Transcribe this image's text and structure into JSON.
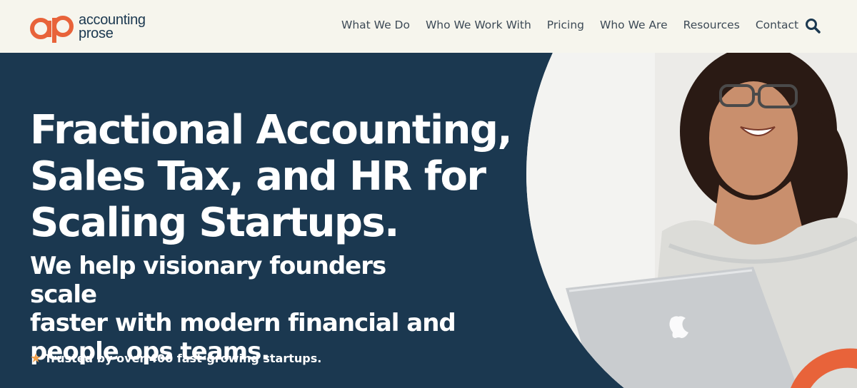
{
  "brand": {
    "logo_mark": "ap",
    "name_line1": "accounting",
    "name_line2": "prose",
    "accent_color": "#e8633a",
    "navy_color": "#1b3850"
  },
  "nav": {
    "items": [
      "What We Do",
      "Who We Work With",
      "Pricing",
      "Who We Are",
      "Resources",
      "Contact"
    ],
    "search_icon": "search-icon"
  },
  "hero": {
    "headline_lines": [
      "Fractional Accounting,",
      "Sales Tax, and HR for",
      "Scaling Startups."
    ],
    "subhead_lines": [
      "We help visionary founders scale",
      "faster with modern financial and",
      "people ops teams."
    ],
    "trust_icon": "star-icon",
    "trust_text": "Trusted by over 400 fast-growing startups."
  }
}
